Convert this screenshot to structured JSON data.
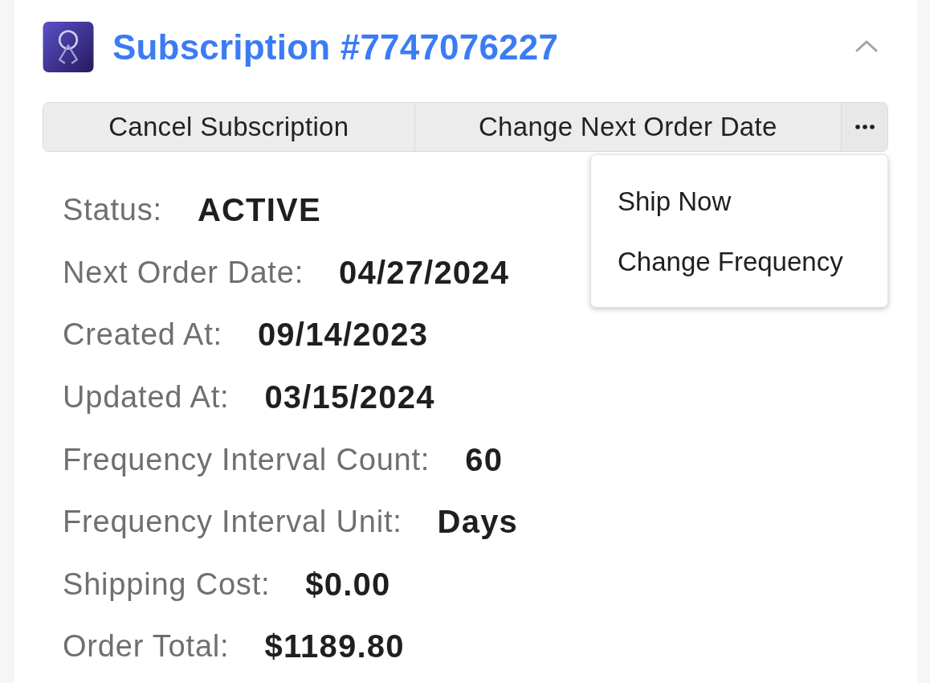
{
  "card": {
    "title": "Subscription #7747076227",
    "expanded": true
  },
  "actions": [
    {
      "label": "Cancel Subscription"
    },
    {
      "label": "Change Next Order Date"
    }
  ],
  "more_menu": {
    "open": true,
    "items": [
      {
        "label": "Ship Now"
      },
      {
        "label": "Change Frequency"
      }
    ]
  },
  "details": [
    {
      "label": "Status:",
      "value": "ACTIVE"
    },
    {
      "label": "Next Order Date:",
      "value": "04/27/2024"
    },
    {
      "label": "Created At:",
      "value": "09/14/2023"
    },
    {
      "label": "Updated At:",
      "value": "03/15/2024"
    },
    {
      "label": "Frequency Interval Count:",
      "value": "60"
    },
    {
      "label": "Frequency Interval Unit:",
      "value": "Days"
    },
    {
      "label": "Shipping Cost:",
      "value": "$0.00"
    },
    {
      "label": "Order Total:",
      "value": "$1189.80"
    }
  ]
}
